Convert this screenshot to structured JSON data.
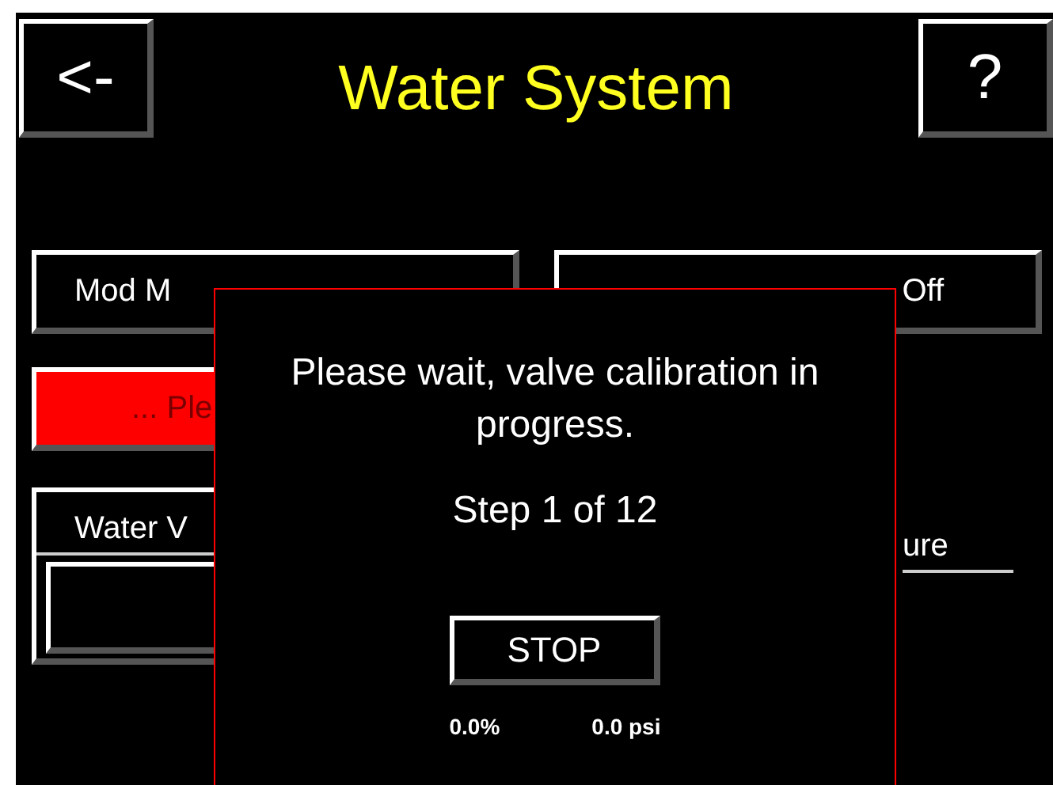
{
  "header": {
    "back": "<-",
    "title": "Water System",
    "help": "?"
  },
  "buttons": [
    {
      "label": "Mod M",
      "kind": "normal"
    },
    {
      "label": "Off",
      "kind": "normal"
    },
    {
      "label": "... Ple",
      "kind": "alarm"
    }
  ],
  "panel": {
    "label": "Water V"
  },
  "right_label": "ure",
  "dialog": {
    "message": "Please wait, valve calibration in progress.",
    "step": "Step 1 of 12",
    "stop": "STOP",
    "percent": "0.0%",
    "pressure": "0.0 psi"
  }
}
